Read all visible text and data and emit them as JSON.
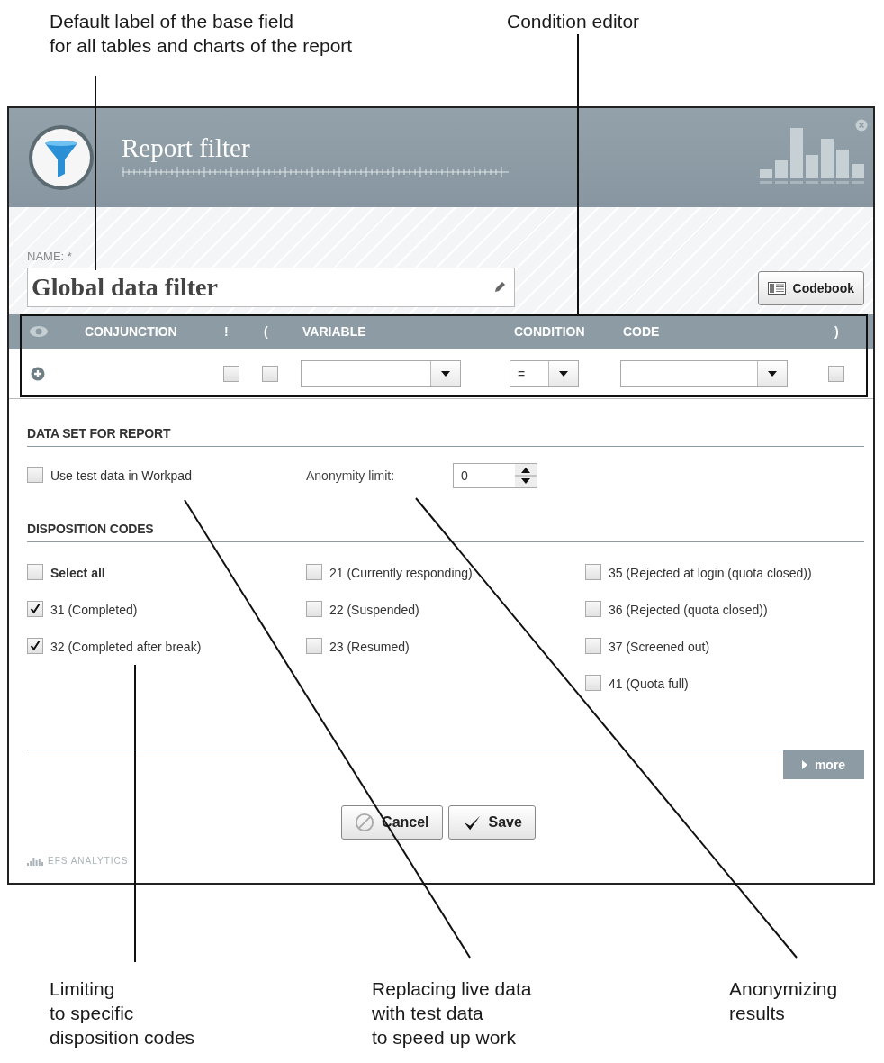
{
  "annotations": {
    "top": [
      {
        "lines": [
          "Default label of the base field",
          "for all tables and charts of the report"
        ]
      },
      {
        "lines": [
          "Condition editor"
        ]
      }
    ],
    "bottom": [
      {
        "lines": [
          "Limiting",
          "to specific",
          "disposition codes"
        ]
      },
      {
        "lines": [
          "Replacing live data",
          "with test data",
          "to speed up work"
        ]
      },
      {
        "lines": [
          "Anonymizing",
          "results"
        ]
      }
    ]
  },
  "dialog": {
    "title": "Report filter",
    "name_label": "NAME: *",
    "name_value": "Global data filter",
    "codebook_button": "Codebook",
    "condition_columns": [
      "CONJUNCTION",
      "!",
      "(",
      "VARIABLE",
      "CONDITION",
      "CODE",
      ")"
    ],
    "condition_row": {
      "not_checked": false,
      "open_paren_checked": false,
      "condition": "=",
      "close_paren_checked": false
    },
    "data_set": {
      "heading": "DATA SET FOR REPORT",
      "test_data": {
        "label": "Use test data in Workpad",
        "checked": false
      },
      "anonymity_label": "Anonymity limit:",
      "anonymity_value": "0"
    },
    "disposition": {
      "heading": "DISPOSITION CODES",
      "columns": [
        [
          {
            "kind": "all",
            "label": "Select all",
            "checked": false
          },
          {
            "kind": "code",
            "label": "31 (Completed)",
            "checked": true
          },
          {
            "kind": "code",
            "label": "32 (Completed after break)",
            "checked": true
          }
        ],
        [
          {
            "kind": "code",
            "label": "21 (Currently responding)",
            "checked": false
          },
          {
            "kind": "code",
            "label": "22 (Suspended)",
            "checked": false
          },
          {
            "kind": "code",
            "label": "23 (Resumed)",
            "checked": false
          }
        ],
        [
          {
            "kind": "code",
            "label": "35 (Rejected at login (quota closed))",
            "checked": false
          },
          {
            "kind": "code",
            "label": "36 (Rejected (quota closed))",
            "checked": false
          },
          {
            "kind": "code",
            "label": "37 (Screened out)",
            "checked": false
          },
          {
            "kind": "code",
            "label": "41 (Quota full)",
            "checked": false
          }
        ]
      ]
    },
    "more_button": "more",
    "cancel_button": "Cancel",
    "save_button": "Save",
    "footer_logo": "EFS ANALYTICS"
  }
}
